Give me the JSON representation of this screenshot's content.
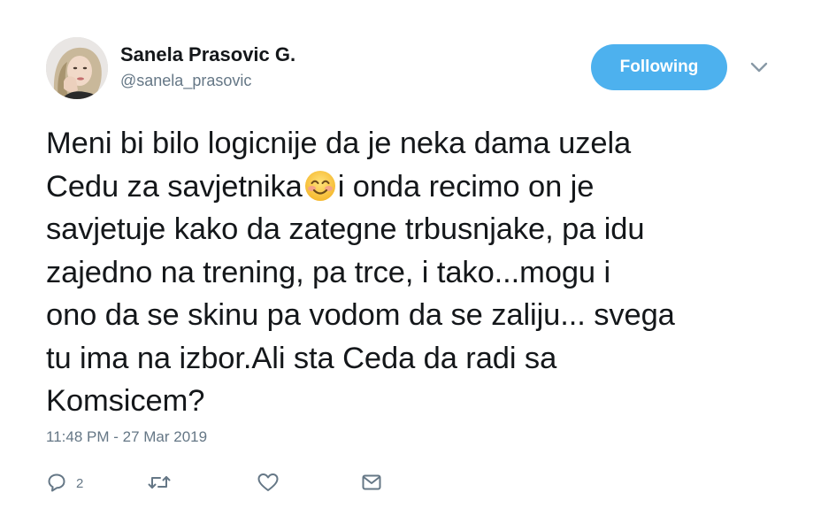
{
  "tweet": {
    "author": {
      "display_name": "Sanela Prasovic G.",
      "handle": "@sanela_prasovic"
    },
    "follow_button_label": "Following",
    "text_lines": [
      {
        "before": "Meni bi bilo logicnije da je neka dama uzela",
        "after": ""
      },
      {
        "before": "Cedu za savjetnika",
        "emoji": "smiling-face-with-smiling-eyes",
        "after": "i onda recimo on je"
      },
      {
        "before": "savjetuje kako da zategne trbusnjake, pa idu",
        "after": ""
      },
      {
        "before": "zajedno na trening, pa trce, i tako...mogu i",
        "after": ""
      },
      {
        "before": "ono da se skinu pa vodom da se zaliju... svega",
        "after": ""
      },
      {
        "before": "tu ima na izbor.Ali sta Ceda da radi sa",
        "after": ""
      },
      {
        "before": "Komsicem?",
        "after": ""
      }
    ],
    "timestamp": "11:48 PM - 27 Mar 2019",
    "actions": {
      "reply_count": "2",
      "retweet_count": "",
      "like_count": ""
    }
  },
  "colors": {
    "follow_button": "#4db1ee",
    "secondary_text": "#657786",
    "primary_text": "#14171a",
    "icon": "#657786"
  },
  "icons": [
    "avatar",
    "chevron-down-icon",
    "emoji-smile-icon",
    "reply-icon",
    "retweet-icon",
    "like-icon",
    "direct-message-icon"
  ]
}
